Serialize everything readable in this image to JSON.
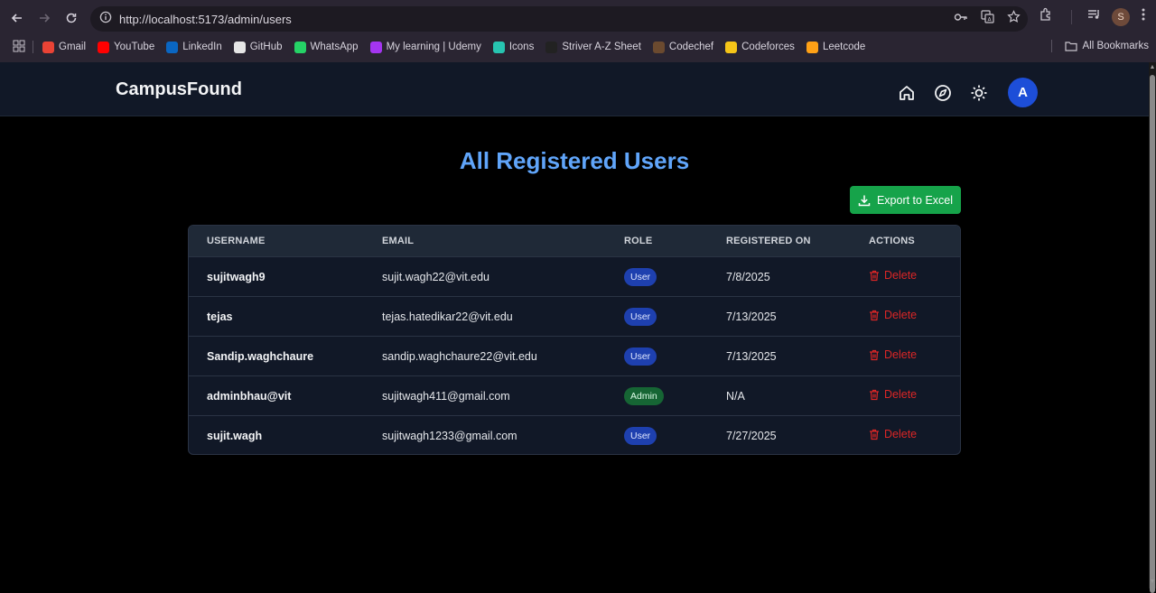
{
  "browser": {
    "url": "http://localhost:5173/admin/users",
    "profile_initial": "S",
    "bookmarks": [
      {
        "label": "Gmail",
        "color": "#ea4335"
      },
      {
        "label": "YouTube",
        "color": "#ff0000"
      },
      {
        "label": "LinkedIn",
        "color": "#0a66c2"
      },
      {
        "label": "GitHub",
        "color": "#e6e6e6"
      },
      {
        "label": "WhatsApp",
        "color": "#25d366"
      },
      {
        "label": "My learning | Udemy",
        "color": "#a435f0"
      },
      {
        "label": "Icons",
        "color": "#27c4b0"
      },
      {
        "label": "Striver A-Z Sheet",
        "color": "#222222"
      },
      {
        "label": "Codechef",
        "color": "#6b4a2f"
      },
      {
        "label": "Codeforces",
        "color": "#f5c518"
      },
      {
        "label": "Leetcode",
        "color": "#ffa116"
      }
    ],
    "all_bookmarks_label": "All Bookmarks"
  },
  "app": {
    "brand": "CampusFound",
    "avatar_initial": "A"
  },
  "main": {
    "title": "All Registered Users",
    "export_label": "Export to Excel",
    "columns": [
      "USERNAME",
      "EMAIL",
      "ROLE",
      "REGISTERED ON",
      "ACTIONS"
    ],
    "rows": [
      {
        "username": "sujitwagh9",
        "email": "sujit.wagh22@vit.edu",
        "role": "User",
        "registered": "7/8/2025",
        "action": "Delete"
      },
      {
        "username": "tejas",
        "email": "tejas.hatedikar22@vit.edu",
        "role": "User",
        "registered": "7/13/2025",
        "action": "Delete"
      },
      {
        "username": "Sandip.waghchaure",
        "email": "sandip.waghchaure22@vit.edu",
        "role": "User",
        "registered": "7/13/2025",
        "action": "Delete"
      },
      {
        "username": "adminbhau@vit",
        "email": "sujitwagh411@gmail.com",
        "role": "Admin",
        "registered": "N/A",
        "action": "Delete"
      },
      {
        "username": "sujit.wagh",
        "email": "sujitwagh1233@gmail.com",
        "role": "User",
        "registered": "7/27/2025",
        "action": "Delete"
      }
    ]
  },
  "colors": {
    "accent_title": "#60a5fa",
    "export_green": "#16a34a",
    "delete_red": "#dc2626",
    "user_badge": "#1e40af",
    "admin_badge": "#166534"
  }
}
